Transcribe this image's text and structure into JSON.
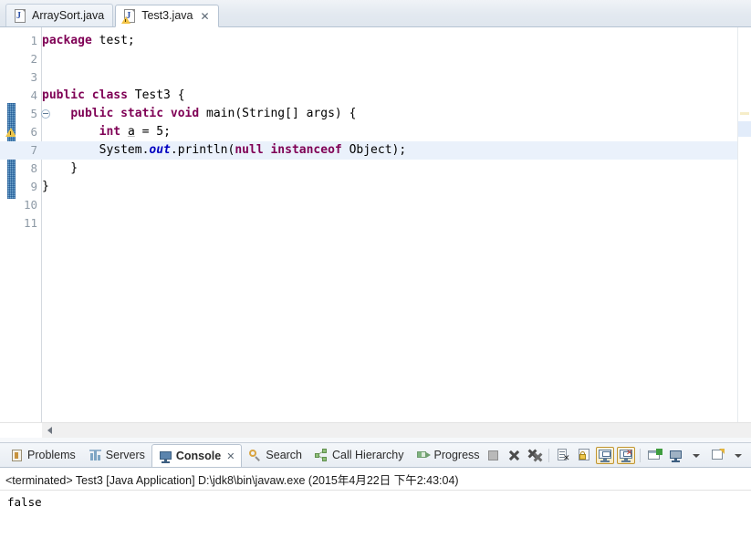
{
  "window": {
    "app": "Eclipse IDE"
  },
  "editor": {
    "tabs": [
      {
        "label": "ArraySort.java",
        "icon": "java-file-icon",
        "active": false,
        "closable": false
      },
      {
        "label": "Test3.java",
        "icon": "java-file-warning-icon",
        "active": true,
        "closable": true,
        "close_glyph": "✕"
      }
    ],
    "gutter_marker": {
      "line": 6,
      "icon": "warning-marker-icon",
      "tooltip": ""
    },
    "current_line": 7,
    "lines": [
      {
        "num": "1",
        "fold": false,
        "tokens": [
          {
            "t": "package ",
            "c": "kw"
          },
          {
            "t": "test;",
            "c": "plain"
          }
        ]
      },
      {
        "num": "2",
        "fold": false,
        "tokens": []
      },
      {
        "num": "3",
        "fold": false,
        "tokens": []
      },
      {
        "num": "4",
        "fold": false,
        "tokens": [
          {
            "t": "public class ",
            "c": "kw"
          },
          {
            "t": "Test3 {",
            "c": "plain"
          }
        ]
      },
      {
        "num": "5",
        "fold": true,
        "tokens": [
          {
            "t": "    ",
            "c": "plain"
          },
          {
            "t": "public static void ",
            "c": "kw"
          },
          {
            "t": "main(String[] args) {",
            "c": "plain"
          }
        ]
      },
      {
        "num": "6",
        "fold": false,
        "tokens": [
          {
            "t": "        ",
            "c": "plain"
          },
          {
            "t": "int ",
            "c": "kw"
          },
          {
            "t": "a = 5;",
            "c": "plain"
          }
        ]
      },
      {
        "num": "7",
        "fold": false,
        "tokens": [
          {
            "t": "        System.",
            "c": "plain"
          },
          {
            "t": "out",
            "c": "fld"
          },
          {
            "t": ".println(",
            "c": "plain"
          },
          {
            "t": "null instanceof ",
            "c": "kw"
          },
          {
            "t": "Object);",
            "c": "plain"
          }
        ]
      },
      {
        "num": "8",
        "fold": false,
        "tokens": [
          {
            "t": "    }",
            "c": "plain"
          }
        ]
      },
      {
        "num": "9",
        "fold": false,
        "tokens": [
          {
            "t": "}",
            "c": "plain"
          }
        ]
      },
      {
        "num": "10",
        "fold": false,
        "tokens": []
      },
      {
        "num": "11",
        "fold": false,
        "tokens": []
      }
    ],
    "scrollbar": {
      "left_arrow_glyph": "◄"
    }
  },
  "bottom_panel": {
    "tabs": [
      {
        "label": "Problems",
        "icon": "problems-icon",
        "active": false,
        "closable": false
      },
      {
        "label": "Servers",
        "icon": "servers-icon",
        "active": false,
        "closable": false
      },
      {
        "label": "Console",
        "icon": "console-icon",
        "active": true,
        "closable": true,
        "close_glyph": "✕"
      },
      {
        "label": "Search",
        "icon": "search-icon",
        "active": false,
        "closable": false
      },
      {
        "label": "Call Hierarchy",
        "icon": "call-hierarchy-icon",
        "active": false,
        "closable": false
      },
      {
        "label": "Progress",
        "icon": "progress-icon",
        "active": false,
        "closable": false
      }
    ],
    "toolbar": [
      {
        "name": "terminate-button",
        "icon": "terminate-icon",
        "pressed": false,
        "disabled": true
      },
      {
        "name": "remove-launch-button",
        "icon": "remove-icon",
        "pressed": false
      },
      {
        "name": "remove-all-launches-button",
        "icon": "remove-all-icon",
        "pressed": false
      },
      {
        "name": "separator-1",
        "icon": "separator",
        "pressed": false
      },
      {
        "name": "clear-console-button",
        "icon": "clear-console-icon",
        "pressed": false
      },
      {
        "name": "scroll-lock-button",
        "icon": "scroll-lock-icon",
        "pressed": false
      },
      {
        "name": "show-console-on-output-button",
        "icon": "show-console-stdout-icon",
        "pressed": true
      },
      {
        "name": "show-console-on-error-button",
        "icon": "show-console-stderr-icon",
        "pressed": true
      },
      {
        "name": "separator-2",
        "icon": "separator",
        "pressed": false
      },
      {
        "name": "pin-console-button",
        "icon": "pin-console-icon",
        "pressed": false
      },
      {
        "name": "display-selected-console-button",
        "icon": "display-console-icon",
        "pressed": false
      },
      {
        "name": "display-console-menu-button",
        "icon": "chevron-down-icon",
        "pressed": false
      },
      {
        "name": "open-console-button",
        "icon": "open-console-icon",
        "pressed": false
      },
      {
        "name": "open-console-menu-button",
        "icon": "chevron-down-icon",
        "pressed": false
      }
    ],
    "console": {
      "header": "<terminated> Test3 [Java Application] D:\\jdk8\\bin\\javaw.exe (2015年4月22日 下午2:43:04)",
      "output": "false"
    }
  }
}
